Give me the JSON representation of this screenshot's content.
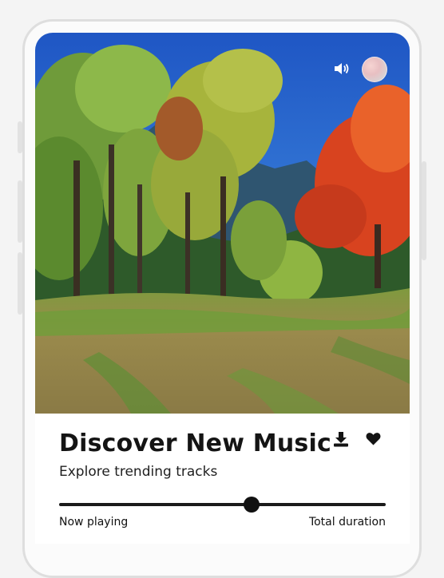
{
  "track": {
    "title": "Discover New Music",
    "subtitle": "Explore trending tracks"
  },
  "player": {
    "progress": 0.59,
    "now_playing_label": "Now playing",
    "total_duration_label": "Total duration"
  },
  "icons": {
    "volume": "volume-icon",
    "avatar": "avatar",
    "download": "download-icon",
    "favorite": "heart-icon"
  },
  "colors": {
    "text": "#141414",
    "progress": "#1a1a1a",
    "background": "#f4f4f4"
  }
}
